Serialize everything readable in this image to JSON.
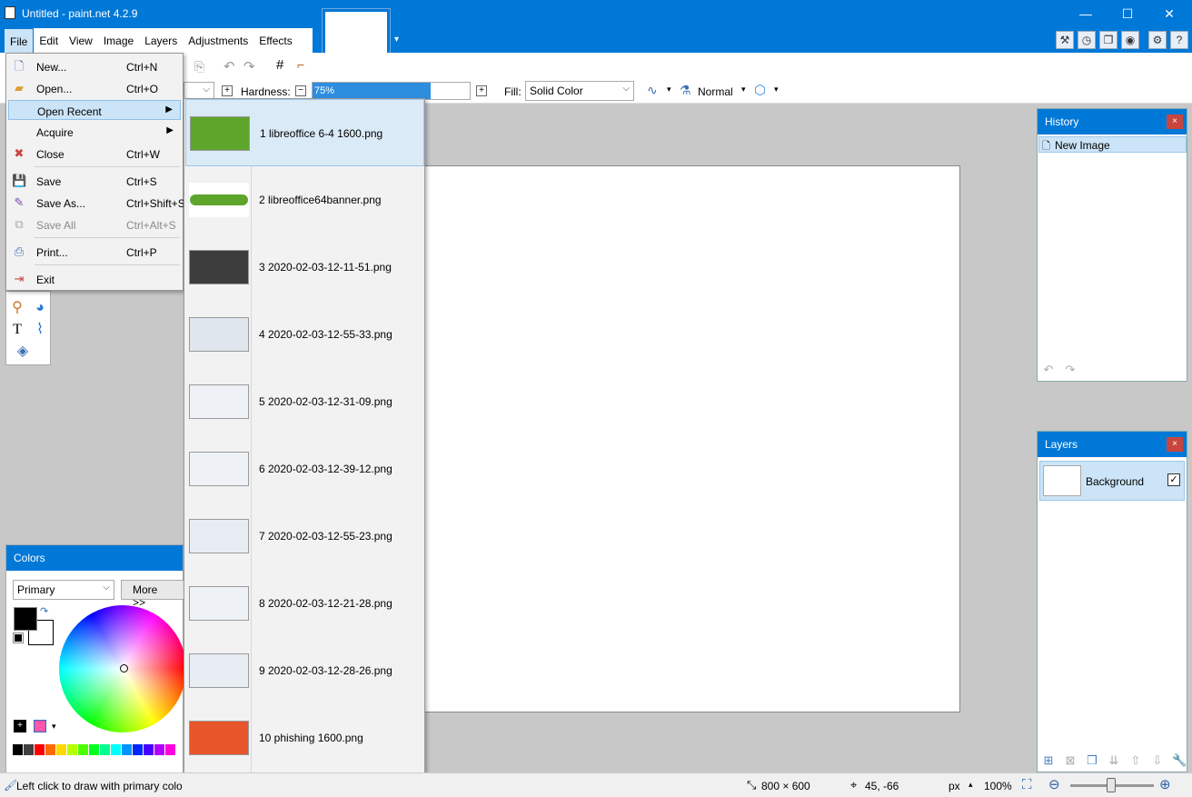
{
  "window": {
    "title": "Untitled - paint.net 4.2.9",
    "minimize": "—",
    "maximize": "☐",
    "close": "✕"
  },
  "menubar": {
    "items": [
      "File",
      "Edit",
      "View",
      "Image",
      "Layers",
      "Adjustments",
      "Effects"
    ]
  },
  "options": {
    "hardness_label": "Hardness:",
    "hardness_value": "75%",
    "hardness_fraction": 0.75,
    "fill_label": "Fill:",
    "fill_value": "Solid Color",
    "blend_value": "Normal"
  },
  "file_menu": {
    "new": {
      "label": "New...",
      "shortcut": "Ctrl+N"
    },
    "open": {
      "label": "Open...",
      "shortcut": "Ctrl+O"
    },
    "open_recent": {
      "label": "Open Recent"
    },
    "acquire": {
      "label": "Acquire"
    },
    "close": {
      "label": "Close",
      "shortcut": "Ctrl+W"
    },
    "save": {
      "label": "Save",
      "shortcut": "Ctrl+S"
    },
    "save_as": {
      "label": "Save As...",
      "shortcut": "Ctrl+Shift+S"
    },
    "save_all": {
      "label": "Save All",
      "shortcut": "Ctrl+Alt+S"
    },
    "print": {
      "label": "Print...",
      "shortcut": "Ctrl+P"
    },
    "exit": {
      "label": "Exit"
    }
  },
  "recent_files": [
    "1 libreoffice 6-4 1600.png",
    "2 libreoffice64banner.png",
    "3 2020-02-03-12-11-51.png",
    "4 2020-02-03-12-55-33.png",
    "5 2020-02-03-12-31-09.png",
    "6 2020-02-03-12-39-12.png",
    "7 2020-02-03-12-55-23.png",
    "8 2020-02-03-12-21-28.png",
    "9 2020-02-03-12-28-26.png",
    "10 phishing 1600.png"
  ],
  "history": {
    "title": "History",
    "items": [
      "New Image"
    ]
  },
  "layers": {
    "title": "Layers",
    "items": [
      "Background"
    ]
  },
  "colors": {
    "title": "Colors",
    "mode": "Primary",
    "more_button": "More >>",
    "primary": "#000000",
    "secondary": "#ffffff"
  },
  "palette": [
    "#000000",
    "#404040",
    "#ff0000",
    "#ff6a00",
    "#ffd800",
    "#b6ff00",
    "#4cff00",
    "#00ff21",
    "#00ff90",
    "#00ffff",
    "#0094ff",
    "#0026ff",
    "#4800ff",
    "#b200ff",
    "#ff00dc"
  ],
  "status": {
    "hint": "Left click to draw with primary colo",
    "image_size": "800 × 600",
    "cursor": "45, -66",
    "units": "px",
    "zoom": "100%"
  },
  "accent_color": "#0078d7"
}
